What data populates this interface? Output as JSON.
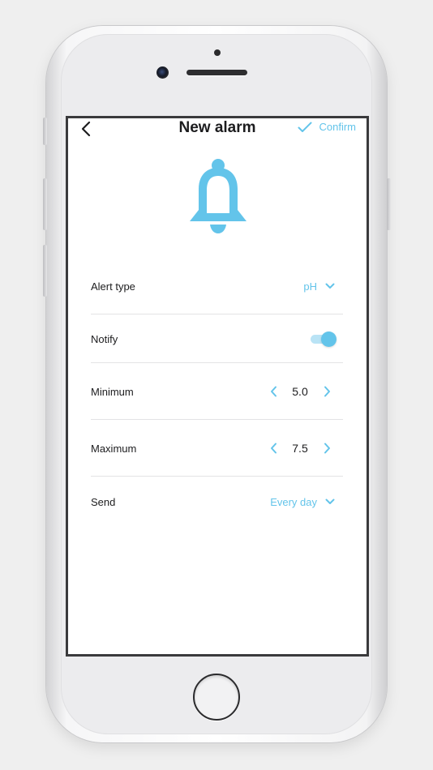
{
  "header": {
    "title": "New alarm",
    "confirm_label": "Confirm"
  },
  "icons": {
    "back": "chevron-left-icon",
    "confirm": "check-icon",
    "bell": "bell-icon",
    "dropdown": "chevron-down-icon",
    "decrement": "chevron-left-icon",
    "increment": "chevron-right-icon"
  },
  "settings": {
    "alert_type": {
      "label": "Alert type",
      "value": "pH"
    },
    "notify": {
      "label": "Notify",
      "enabled": true
    },
    "minimum": {
      "label": "Minimum",
      "value": "5.0"
    },
    "maximum": {
      "label": "Maximum",
      "value": "7.5"
    },
    "send": {
      "label": "Send",
      "value": "Every day"
    }
  },
  "colors": {
    "accent": "#63c4ea",
    "accent_light": "#b9e3f5",
    "text": "#1c1c1e",
    "divider": "#e3e3e5"
  }
}
